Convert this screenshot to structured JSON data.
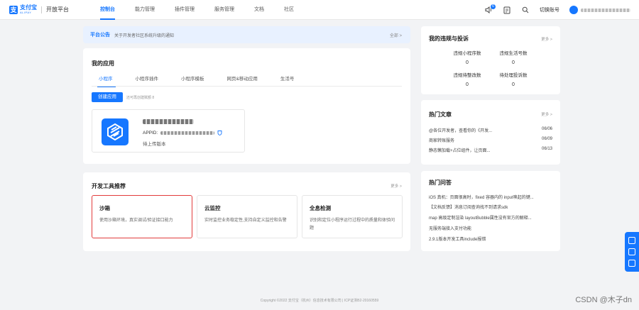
{
  "brand": {
    "logo_cn": "支付宝",
    "logo_en": "ALIPAY",
    "platform": "开放平台",
    "accent": "#1677ff"
  },
  "nav": {
    "items": [
      "控制台",
      "能力管理",
      "插件管理",
      "服务管理",
      "文档",
      "社区"
    ],
    "active_index": 0
  },
  "header_right": {
    "notification_count": "6",
    "switch_account": "切换账号"
  },
  "notice": {
    "title": "平台公告",
    "text": "关于开发者社区系统升级的通知",
    "more": "全部 >"
  },
  "my_apps": {
    "title": "我的应用",
    "tabs": [
      "小程序",
      "小程序插件",
      "小程序模板",
      "网页&移动应用",
      "生活号"
    ],
    "active_tab": 0,
    "create_button": "创建应用",
    "create_hint": "还可再创建赋额 8",
    "app": {
      "appid_label": "APPID:",
      "status": "待上传版本"
    }
  },
  "dev_tools": {
    "title": "开发工具推荐",
    "more": "更多 >",
    "items": [
      {
        "title": "沙箱",
        "desc": "使用沙箱环境，真实调试/验证接口能力"
      },
      {
        "title": "云监控",
        "desc": "实时监控业务稳定性,支持自定义监控和告警"
      },
      {
        "title": "全息检测",
        "desc": "识别和定位小程序运行过程中的质量和体验问题"
      }
    ]
  },
  "violations": {
    "title": "我的违规与投诉",
    "more": "更多 >",
    "stats": [
      {
        "label": "违规小程序数",
        "value": "0"
      },
      {
        "label": "违规生活号数",
        "value": "0"
      },
      {
        "label": "违规待整改数",
        "value": "0"
      },
      {
        "label": "待处理投诉数",
        "value": "0"
      }
    ]
  },
  "articles": {
    "title": "热门文章",
    "more": "更多 >",
    "items": [
      {
        "text": "@各位开发者，查看你的《开发...",
        "date": "06/06"
      },
      {
        "text": "商家转账服务",
        "date": "06/09"
      },
      {
        "text": "静态懒加载+占位组件，让页面...",
        "date": "06/13"
      }
    ]
  },
  "qa": {
    "title": "热门问答",
    "items": [
      "iOS 真机：页面很高时，fixed 容器内的 input唤起的键...",
      "【文档反馈】消息订阅查询找不到请求sdk",
      "map 高级定制渲染 layoutBubble属性没有官方的解释...",
      "无服务端接入支付功能",
      "2.9.1版本开发工具include报错"
    ]
  },
  "footer": "Copyright ©2022 支付宝（杭州）信息技术有限公司 | ICP证浙B2-20160559",
  "watermark": "CSDN @木子dn"
}
